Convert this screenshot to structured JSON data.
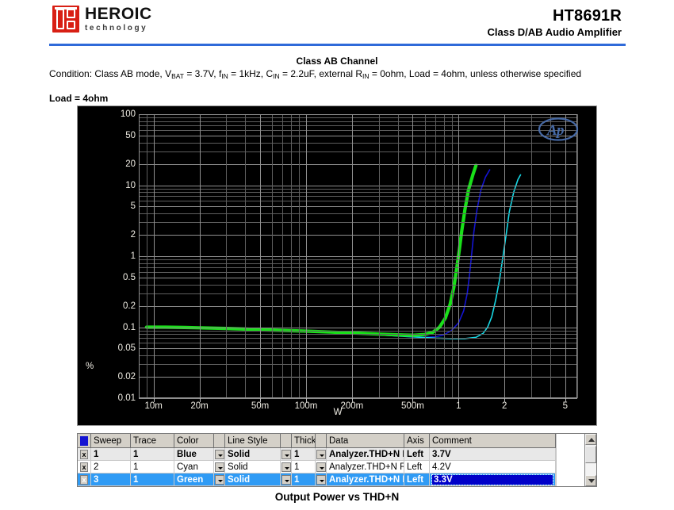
{
  "header": {
    "logo_title": "HEROIC",
    "logo_subtitle": "technology",
    "logo_icon": "heroic-seal-logo",
    "part_number": "HT8691R",
    "part_description": "Class D/AB Audio Amplifier",
    "accent_color": "#2f6ad9"
  },
  "section": {
    "title": "Class AB Channel",
    "condition_prefix": "Condition: Class AB mode, ",
    "condition_parts": [
      "V",
      "BAT",
      " = 3.7V, ",
      "f",
      "IN",
      " = 1kHz, ",
      "C",
      "IN",
      " = 2.2uF, external ",
      "R",
      "IN",
      " = 0ohm, Load = 4ohm, unless otherwise specified"
    ],
    "load_line": "Load = 4ohm"
  },
  "figure": {
    "caption": "Output Power vs THD+N",
    "watermark": "AP"
  },
  "chart_data": {
    "type": "line",
    "title": "Output Power vs THD+N",
    "xlabel": "W",
    "ylabel": "%",
    "xscale": "log",
    "yscale": "log",
    "xlim": [
      0.008,
      6.0
    ],
    "ylim": [
      0.01,
      100
    ],
    "grid": true,
    "background": "#000000",
    "axis_text_color": "#f0ede4",
    "gridline_color": "#8f8f8f",
    "legend_position": "table-below",
    "xticks": [
      0.01,
      0.02,
      0.05,
      0.1,
      0.2,
      0.5,
      1,
      2,
      5
    ],
    "xticklabels": [
      "10m",
      "20m",
      "50m",
      "100m",
      "200m",
      "500m",
      "1",
      "2",
      "5"
    ],
    "yticks": [
      0.01,
      0.02,
      0.05,
      0.1,
      0.2,
      0.5,
      1,
      2,
      5,
      10,
      20,
      50,
      100
    ],
    "yticklabels": [
      "0.01",
      "0.02",
      "0.05",
      "0.1",
      "0.2",
      "0.5",
      "1",
      "2",
      "5",
      "10",
      "20",
      "50",
      "100"
    ],
    "series": [
      {
        "name": "3.7V",
        "sweep": 1,
        "color": "#1414d2",
        "color_name": "Blue",
        "thickness": 1,
        "points": [
          [
            0.009,
            0.098
          ],
          [
            0.012,
            0.098
          ],
          [
            0.016,
            0.097
          ],
          [
            0.02,
            0.096
          ],
          [
            0.03,
            0.094
          ],
          [
            0.04,
            0.092
          ],
          [
            0.05,
            0.09
          ],
          [
            0.07,
            0.088
          ],
          [
            0.1,
            0.086
          ],
          [
            0.15,
            0.083
          ],
          [
            0.2,
            0.081
          ],
          [
            0.3,
            0.078
          ],
          [
            0.4,
            0.075
          ],
          [
            0.5,
            0.073
          ],
          [
            0.6,
            0.072
          ],
          [
            0.7,
            0.073
          ],
          [
            0.8,
            0.078
          ],
          [
            0.9,
            0.09
          ],
          [
            1.0,
            0.115
          ],
          [
            1.08,
            0.17
          ],
          [
            1.14,
            0.3
          ],
          [
            1.18,
            0.55
          ],
          [
            1.22,
            1.1
          ],
          [
            1.26,
            2.2
          ],
          [
            1.32,
            4.5
          ],
          [
            1.4,
            8.5
          ],
          [
            1.5,
            13.0
          ],
          [
            1.6,
            16.5
          ]
        ]
      },
      {
        "name": "4.2V",
        "sweep": 2,
        "color": "#17d9e6",
        "color_name": "Cyan",
        "thickness": 1,
        "points": [
          [
            0.009,
            0.098
          ],
          [
            0.012,
            0.098
          ],
          [
            0.016,
            0.097
          ],
          [
            0.02,
            0.096
          ],
          [
            0.03,
            0.094
          ],
          [
            0.04,
            0.092
          ],
          [
            0.05,
            0.09
          ],
          [
            0.07,
            0.088
          ],
          [
            0.1,
            0.086
          ],
          [
            0.15,
            0.083
          ],
          [
            0.2,
            0.081
          ],
          [
            0.3,
            0.078
          ],
          [
            0.4,
            0.075
          ],
          [
            0.5,
            0.073
          ],
          [
            0.7,
            0.07
          ],
          [
            0.9,
            0.069
          ],
          [
            1.1,
            0.069
          ],
          [
            1.3,
            0.072
          ],
          [
            1.45,
            0.082
          ],
          [
            1.55,
            0.1
          ],
          [
            1.65,
            0.14
          ],
          [
            1.75,
            0.24
          ],
          [
            1.85,
            0.45
          ],
          [
            1.95,
            0.95
          ],
          [
            2.05,
            2.0
          ],
          [
            2.15,
            4.2
          ],
          [
            2.3,
            8.0
          ],
          [
            2.45,
            12.0
          ],
          [
            2.55,
            14.0
          ]
        ]
      },
      {
        "name": "3.3V",
        "sweep": 3,
        "color": "#19e019",
        "color_name": "Green",
        "thickness": 3,
        "points": [
          [
            0.009,
            0.1
          ],
          [
            0.012,
            0.1
          ],
          [
            0.016,
            0.099
          ],
          [
            0.02,
            0.098
          ],
          [
            0.03,
            0.096
          ],
          [
            0.04,
            0.094
          ],
          [
            0.05,
            0.092
          ],
          [
            0.07,
            0.09
          ],
          [
            0.1,
            0.088
          ],
          [
            0.15,
            0.085
          ],
          [
            0.2,
            0.083
          ],
          [
            0.3,
            0.08
          ],
          [
            0.4,
            0.078
          ],
          [
            0.5,
            0.077
          ],
          [
            0.6,
            0.079
          ],
          [
            0.68,
            0.085
          ],
          [
            0.75,
            0.1
          ],
          [
            0.82,
            0.135
          ],
          [
            0.88,
            0.21
          ],
          [
            0.93,
            0.36
          ],
          [
            0.97,
            0.65
          ],
          [
            1.01,
            1.2
          ],
          [
            1.05,
            2.3
          ],
          [
            1.1,
            4.5
          ],
          [
            1.16,
            8.5
          ],
          [
            1.24,
            14.0
          ],
          [
            1.3,
            19.0
          ]
        ]
      }
    ]
  },
  "legend_table": {
    "columns": [
      "Sweep",
      "Trace",
      "Color",
      "Line Style",
      "Thick",
      "Data",
      "Axis",
      "Comment"
    ],
    "header_swatch_color": "#1414d2",
    "rows": [
      {
        "enabled_label": "x",
        "sweep": "1",
        "trace": "1",
        "color": "Blue",
        "line_style": "Solid",
        "thick": "1",
        "data": "Analyzer.THD+N L",
        "axis": "Left",
        "comment": "3.7V"
      },
      {
        "enabled_label": "x",
        "sweep": "2",
        "trace": "1",
        "color": "Cyan",
        "line_style": "Solid",
        "thick": "1",
        "data": "Analyzer.THD+N R",
        "axis": "Left",
        "comment": "4.2V"
      },
      {
        "enabled_label": "x",
        "sweep": "3",
        "trace": "1",
        "color": "Green",
        "line_style": "Solid",
        "thick": "1",
        "data": "Analyzer.THD+N L",
        "axis": "Left",
        "comment": "3.3V"
      }
    ]
  }
}
